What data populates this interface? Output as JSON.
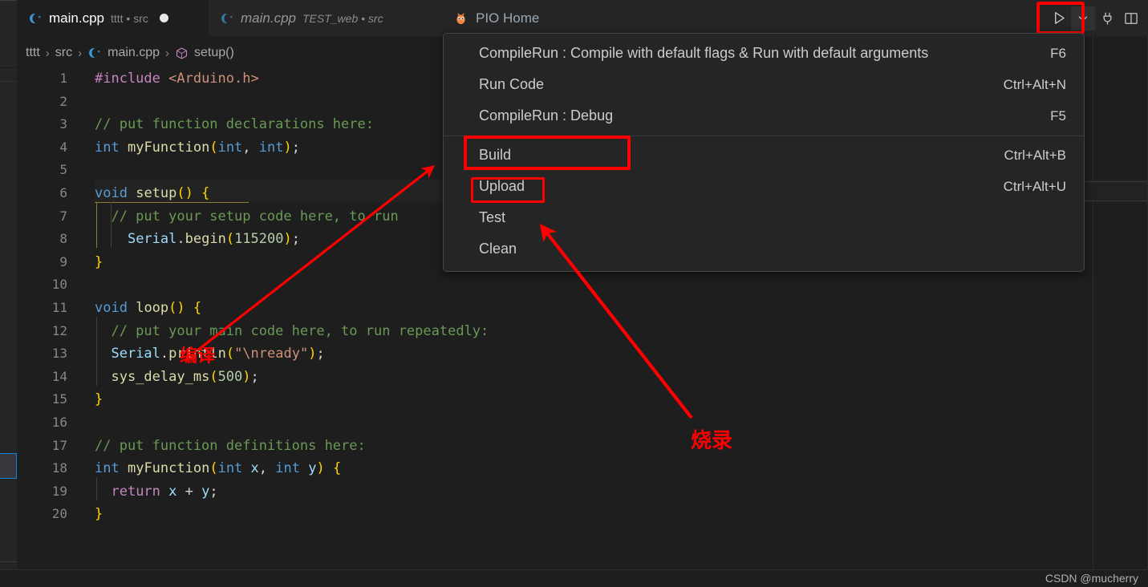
{
  "window": {
    "background": "#1e1e1e",
    "accent_red": "#fe0000",
    "focus_blue": "#0a84e2"
  },
  "tabs": [
    {
      "icon": "cpp-file-icon",
      "name": "main.cpp",
      "meta": "tttt • src",
      "active": true,
      "dirty": true,
      "italic": false
    },
    {
      "icon": "cpp-file-icon",
      "name": "main.cpp",
      "meta": "TEST_web • src",
      "active": false,
      "dirty": false,
      "italic": true
    },
    {
      "icon": "platformio-icon",
      "name": "PIO Home",
      "meta": "",
      "active": false,
      "dirty": false,
      "italic": false
    }
  ],
  "tab_actions": [
    {
      "name": "run-button",
      "icon": "play-icon",
      "label": "Run"
    },
    {
      "name": "run-dropdown-button",
      "icon": "chevron-down-icon",
      "label": "Run dropdown"
    },
    {
      "name": "serial-monitor-button",
      "icon": "plug-icon",
      "label": "Serial Monitor"
    },
    {
      "name": "split-editor-button",
      "icon": "split-editor-icon",
      "label": "Split Editor Right"
    }
  ],
  "breadcrumb": {
    "items": [
      {
        "label": "tttt",
        "icon": ""
      },
      {
        "label": "src",
        "icon": ""
      },
      {
        "label": "main.cpp",
        "icon": "cpp-file-icon"
      },
      {
        "label": "setup()",
        "icon": "symbol-cube-icon"
      }
    ],
    "separator": "›"
  },
  "menu": {
    "items": [
      {
        "label": "CompileRun : Compile with default flags & Run with default arguments",
        "keys": "F6",
        "separator_after": false,
        "highlighted": false
      },
      {
        "label": "Run Code",
        "keys": "Ctrl+Alt+N",
        "separator_after": false,
        "highlighted": false
      },
      {
        "label": "CompileRun : Debug",
        "keys": "F5",
        "separator_after": true,
        "highlighted": false
      },
      {
        "label": "Build",
        "keys": "Ctrl+Alt+B",
        "separator_after": false,
        "highlighted": true
      },
      {
        "label": "Upload",
        "keys": "Ctrl+Alt+U",
        "separator_after": false,
        "highlighted": true
      },
      {
        "label": "Test",
        "keys": "",
        "separator_after": false,
        "highlighted": false
      },
      {
        "label": "Clean",
        "keys": "",
        "separator_after": false,
        "highlighted": false
      }
    ]
  },
  "editor": {
    "language": "cpp",
    "current_line": 6,
    "lines": [
      {
        "n": 1,
        "tokens": [
          {
            "t": "#include ",
            "c": "t-pre"
          },
          {
            "t": "<Arduino.h>",
            "c": "t-str"
          }
        ]
      },
      {
        "n": 2,
        "tokens": []
      },
      {
        "n": 3,
        "tokens": [
          {
            "t": "// put function declarations here:",
            "c": "t-cmt"
          }
        ]
      },
      {
        "n": 4,
        "tokens": [
          {
            "t": "int",
            "c": "t-kw"
          },
          {
            "t": " ",
            "c": "t-plain"
          },
          {
            "t": "myFunction",
            "c": "t-fn"
          },
          {
            "t": "(",
            "c": "t-br1"
          },
          {
            "t": "int",
            "c": "t-kw"
          },
          {
            "t": ", ",
            "c": "t-plain"
          },
          {
            "t": "int",
            "c": "t-kw"
          },
          {
            "t": ")",
            "c": "t-br1"
          },
          {
            "t": ";",
            "c": "t-plain"
          }
        ]
      },
      {
        "n": 5,
        "tokens": []
      },
      {
        "n": 6,
        "tokens": [
          {
            "t": "void",
            "c": "t-kw"
          },
          {
            "t": " ",
            "c": "t-plain"
          },
          {
            "t": "setup",
            "c": "t-fn"
          },
          {
            "t": "()",
            "c": "t-br1"
          },
          {
            "t": " ",
            "c": "t-plain"
          },
          {
            "t": "{",
            "c": "t-br1"
          }
        ]
      },
      {
        "n": 7,
        "tokens": [
          {
            "t": "  // put your setup code here, to run",
            "c": "t-cmt"
          }
        ]
      },
      {
        "n": 8,
        "tokens": [
          {
            "t": "    ",
            "c": "t-plain"
          },
          {
            "t": "Serial",
            "c": "t-var"
          },
          {
            "t": ".",
            "c": "t-plain"
          },
          {
            "t": "begin",
            "c": "t-fn"
          },
          {
            "t": "(",
            "c": "t-br1"
          },
          {
            "t": "115200",
            "c": "t-num"
          },
          {
            "t": ")",
            "c": "t-br1"
          },
          {
            "t": ";",
            "c": "t-plain"
          }
        ]
      },
      {
        "n": 9,
        "tokens": [
          {
            "t": "}",
            "c": "t-br1"
          }
        ]
      },
      {
        "n": 10,
        "tokens": []
      },
      {
        "n": 11,
        "tokens": [
          {
            "t": "void",
            "c": "t-kw"
          },
          {
            "t": " ",
            "c": "t-plain"
          },
          {
            "t": "loop",
            "c": "t-fn"
          },
          {
            "t": "()",
            "c": "t-br1"
          },
          {
            "t": " ",
            "c": "t-plain"
          },
          {
            "t": "{",
            "c": "t-br1"
          }
        ]
      },
      {
        "n": 12,
        "tokens": [
          {
            "t": "  // put your main code here, to run repeatedly:",
            "c": "t-cmt"
          }
        ]
      },
      {
        "n": 13,
        "tokens": [
          {
            "t": "  ",
            "c": "t-plain"
          },
          {
            "t": "Serial",
            "c": "t-var"
          },
          {
            "t": ".",
            "c": "t-plain"
          },
          {
            "t": "println",
            "c": "t-fn"
          },
          {
            "t": "(",
            "c": "t-br1"
          },
          {
            "t": "\"\\nready\"",
            "c": "t-str"
          },
          {
            "t": ")",
            "c": "t-br1"
          },
          {
            "t": ";",
            "c": "t-plain"
          }
        ]
      },
      {
        "n": 14,
        "tokens": [
          {
            "t": "  ",
            "c": "t-plain"
          },
          {
            "t": "sys_delay_ms",
            "c": "t-fn"
          },
          {
            "t": "(",
            "c": "t-br1"
          },
          {
            "t": "500",
            "c": "t-num"
          },
          {
            "t": ")",
            "c": "t-br1"
          },
          {
            "t": ";",
            "c": "t-plain"
          }
        ]
      },
      {
        "n": 15,
        "tokens": [
          {
            "t": "}",
            "c": "t-br1"
          }
        ]
      },
      {
        "n": 16,
        "tokens": []
      },
      {
        "n": 17,
        "tokens": [
          {
            "t": "// put function definitions here:",
            "c": "t-cmt"
          }
        ]
      },
      {
        "n": 18,
        "tokens": [
          {
            "t": "int",
            "c": "t-kw"
          },
          {
            "t": " ",
            "c": "t-plain"
          },
          {
            "t": "myFunction",
            "c": "t-fn"
          },
          {
            "t": "(",
            "c": "t-br1"
          },
          {
            "t": "int",
            "c": "t-kw"
          },
          {
            "t": " ",
            "c": "t-plain"
          },
          {
            "t": "x",
            "c": "t-var"
          },
          {
            "t": ", ",
            "c": "t-plain"
          },
          {
            "t": "int",
            "c": "t-kw"
          },
          {
            "t": " ",
            "c": "t-plain"
          },
          {
            "t": "y",
            "c": "t-var"
          },
          {
            "t": ")",
            "c": "t-br1"
          },
          {
            "t": " ",
            "c": "t-plain"
          },
          {
            "t": "{",
            "c": "t-br1"
          }
        ]
      },
      {
        "n": 19,
        "tokens": [
          {
            "t": "  ",
            "c": "t-plain"
          },
          {
            "t": "return",
            "c": "t-ctl"
          },
          {
            "t": " ",
            "c": "t-plain"
          },
          {
            "t": "x",
            "c": "t-var"
          },
          {
            "t": " + ",
            "c": "t-plain"
          },
          {
            "t": "y",
            "c": "t-var"
          },
          {
            "t": ";",
            "c": "t-plain"
          }
        ]
      },
      {
        "n": 20,
        "tokens": [
          {
            "t": "}",
            "c": "t-br1"
          }
        ]
      }
    ]
  },
  "annotations": [
    {
      "name": "annotation-compile",
      "text": "编译",
      "color": "#fe0000",
      "points_to": "run-button"
    },
    {
      "name": "annotation-burn",
      "text": "烧录",
      "color": "#fe0000",
      "points_to": "menu-item-upload"
    }
  ],
  "watermark": {
    "text": "CSDN @mucherry"
  }
}
